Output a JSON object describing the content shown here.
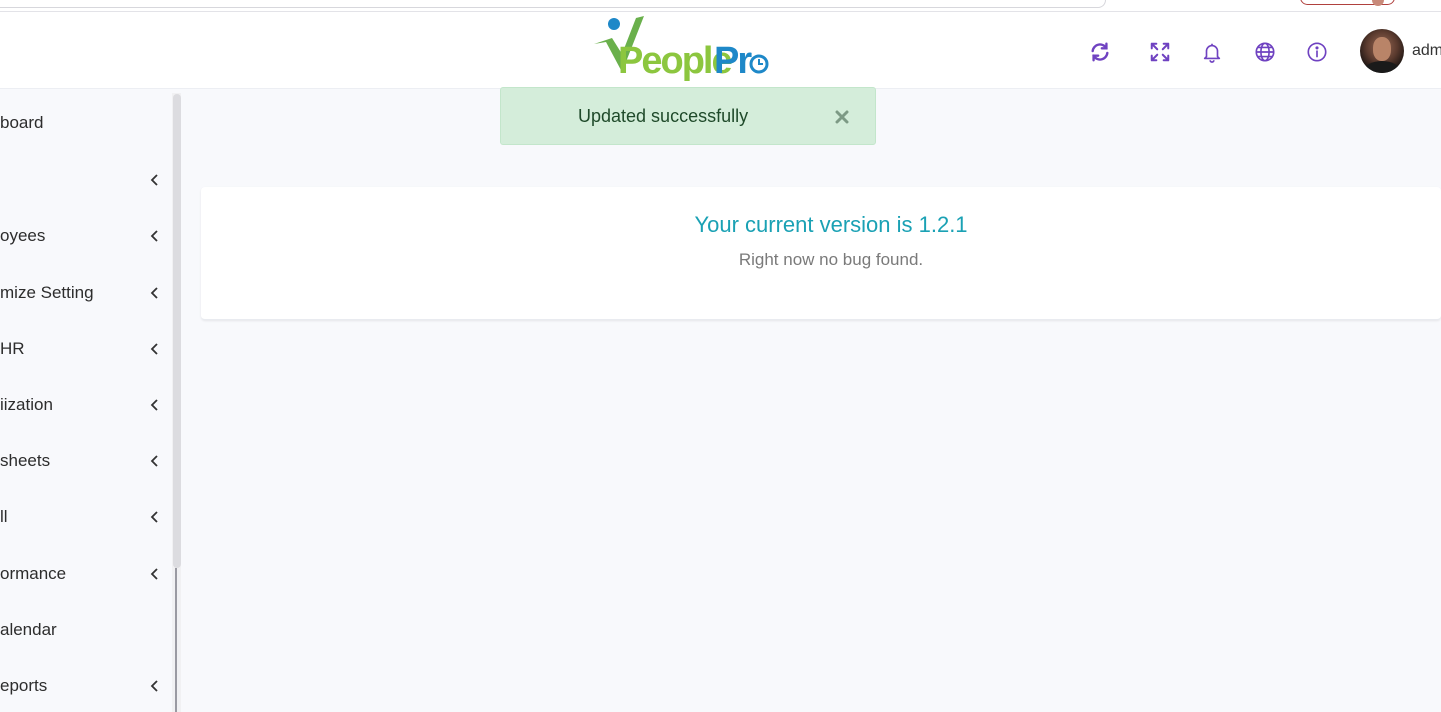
{
  "header": {
    "logo_text_people": "People",
    "logo_text_pro": "Pr",
    "icons": [
      "refresh-icon",
      "fullscreen-icon",
      "bell-icon",
      "globe-icon",
      "info-icon"
    ],
    "user_name": "adm"
  },
  "sidebar": {
    "items": [
      {
        "label": "board",
        "has_chevron": false
      },
      {
        "label": "",
        "has_chevron": true
      },
      {
        "label": "oyees",
        "has_chevron": true
      },
      {
        "label": "mize Setting",
        "has_chevron": true
      },
      {
        "label": "HR",
        "has_chevron": true
      },
      {
        "label": "iization",
        "has_chevron": true
      },
      {
        "label": "sheets",
        "has_chevron": true
      },
      {
        "label": "ll",
        "has_chevron": true
      },
      {
        "label": "ormance",
        "has_chevron": true
      },
      {
        "label": "alendar",
        "has_chevron": false
      },
      {
        "label": "eports",
        "has_chevron": true
      }
    ]
  },
  "toast": {
    "message": "Updated successfully",
    "close_symbol": "×"
  },
  "main": {
    "version_text": "Your current version is 1.2.1",
    "bug_text": "Right now no bug found."
  },
  "colors": {
    "accent_purple": "#6f42c1",
    "toast_bg": "#d4edda",
    "version_teal": "#1aa1b4",
    "logo_green": "#8cc63f",
    "logo_blue": "#1e88c8"
  }
}
